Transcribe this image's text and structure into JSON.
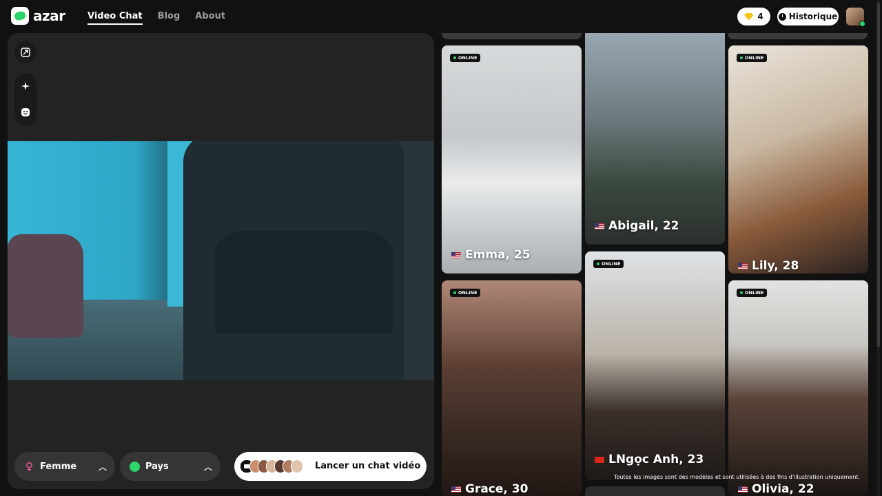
{
  "header": {
    "logo_text": "azar",
    "nav": [
      {
        "label": "Video Chat",
        "active": true
      },
      {
        "label": "Blog",
        "active": false
      },
      {
        "label": "About",
        "active": false
      }
    ],
    "gems_count": "4",
    "history_label": "Historique"
  },
  "tools": [
    "expand-icon",
    "sparkle-icon",
    "face-icon"
  ],
  "controls": {
    "gender_label": "Femme",
    "country_label": "Pays",
    "start_label": "Lancer un chat vidéo"
  },
  "cards": [
    {
      "name": "Emma, 25",
      "badge": "ONLINE",
      "flag": "us"
    },
    {
      "name": "Abigail, 22",
      "badge": "",
      "flag": "us"
    },
    {
      "name": "Lily, 28",
      "badge": "ONLINE",
      "flag": "us"
    },
    {
      "name": "Grace, 30",
      "badge": "ONLINE",
      "flag": "us"
    },
    {
      "name": "LNgọc Anh, 23",
      "badge": "ONLINE",
      "flag": "vn"
    },
    {
      "name": "Olivia, 22",
      "badge": "ONLINE",
      "flag": "us"
    }
  ],
  "disclaimer": "Toutes les images sont des modèles et sont utilisées à des fins d'illustration uniquement.",
  "colors": {
    "accent": "#2bd66b",
    "female": "#ff5ea8",
    "background": "#111111",
    "panel": "#232323"
  }
}
